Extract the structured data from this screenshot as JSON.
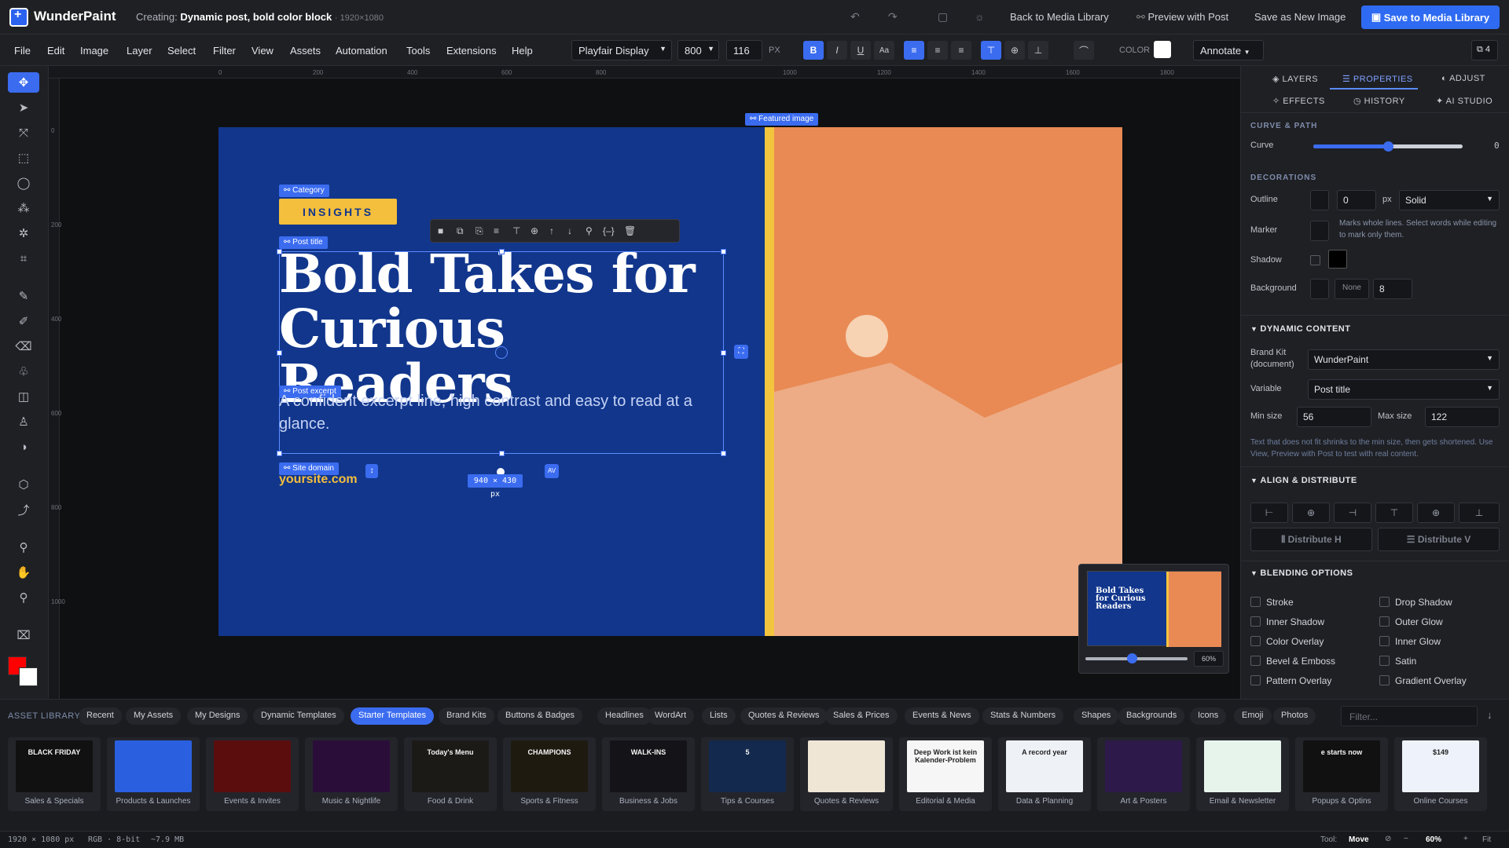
{
  "app": {
    "name": "WunderPaint",
    "creating_label": "Creating:",
    "doc_title": "Dynamic post, bold color block",
    "doc_size": "· 1920×1080"
  },
  "titlebar": {
    "back": "Back to Media Library",
    "preview": "Preview with Post",
    "save_new": "Save as New Image",
    "save_lib": "Save to Media Library"
  },
  "menu": [
    "File",
    "Edit",
    "Image",
    "Layer",
    "Select",
    "Filter",
    "View",
    "Assets",
    "Automation",
    "Tools",
    "Extensions",
    "Help"
  ],
  "format": {
    "font": "Playfair Display",
    "weight": "800",
    "size": "116",
    "unit": "PX",
    "color_label": "COLOR",
    "annotate": "Annotate",
    "panels_count": "4"
  },
  "ruler_top": [
    "0",
    "200",
    "400",
    "600",
    "800",
    "1000",
    "1200",
    "1400",
    "1600",
    "1800"
  ],
  "ruler_left": [
    "0",
    "200",
    "400",
    "600",
    "800",
    "1000"
  ],
  "canvas": {
    "tag_category": "Category",
    "category": "INSIGHTS",
    "tag_title": "Post title",
    "title": "Bold Takes for Curious Readers",
    "tag_excerpt": "Post excerpt",
    "excerpt": "A confident excerpt line, high contrast and easy to read at a glance.",
    "tag_domain": "Site domain",
    "domain": "yoursite.com",
    "tag_featured": "Featured image",
    "size_badge": "940 × 430 px",
    "nav_zoom": "60%",
    "nav_zoom_level": 0.45
  },
  "colors": {
    "accent": "#3b6cf0",
    "artboard": "#11368c",
    "yellow": "#f4bf3c",
    "orange": "#e98a54",
    "fg": "#ff0000",
    "bg": "#ffffff"
  },
  "panel": {
    "tabs": [
      "LAYERS",
      "PROPERTIES",
      "ADJUST",
      "EFFECTS",
      "HISTORY",
      "AI STUDIO"
    ],
    "curve_section": "CURVE & PATH",
    "curve_label": "Curve",
    "curve_value": "0",
    "curve_level": 0.5,
    "deco_section": "DECORATIONS",
    "outline_label": "Outline",
    "outline_value": "0",
    "outline_unit": "px",
    "outline_style": "Solid",
    "marker_label": "Marker",
    "marker_note": "Marks whole lines. Select words while editing to mark only them.",
    "shadow_label": "Shadow",
    "background_label": "Background",
    "background_none": "None",
    "background_value": "8",
    "dyn_section": "DYNAMIC CONTENT",
    "brandkit_label": "Brand Kit (document)",
    "brandkit_value": "WunderPaint",
    "variable_label": "Variable",
    "variable_value": "Post title",
    "min_label": "Min size",
    "min_value": "56",
    "max_label": "Max size",
    "max_value": "122",
    "dyn_note": "Text that does not fit shrinks to the min size, then gets shortened. Use View, Preview with Post to test with real content.",
    "align_section": "ALIGN & DISTRIBUTE",
    "dist_h": "Distribute H",
    "dist_v": "Distribute V",
    "blend_section": "BLENDING OPTIONS",
    "blend": [
      "Stroke",
      "Drop Shadow",
      "Inner Shadow",
      "Outer Glow",
      "Color Overlay",
      "Inner Glow",
      "Bevel & Emboss",
      "Satin",
      "Pattern Overlay",
      "Gradient Overlay"
    ]
  },
  "assets": {
    "title": "ASSET LIBRARY",
    "tabs": [
      "Recent",
      "My Assets",
      "My Designs",
      "Dynamic Templates",
      "Starter Templates",
      "Brand Kits",
      "Buttons & Badges",
      "Headlines",
      "WordArt",
      "Lists",
      "Quotes & Reviews",
      "Sales & Prices",
      "Events & News",
      "Stats & Numbers",
      "Shapes",
      "Backgrounds",
      "Icons",
      "Emoji",
      "Photos"
    ],
    "filter_placeholder": "Filter...",
    "cards": [
      {
        "label": "Sales & Specials",
        "thumb": "BLACK FRIDAY",
        "c": "#111111"
      },
      {
        "label": "Products & Launches",
        "thumb": "",
        "c": "#2a5fe0"
      },
      {
        "label": "Events & Invites",
        "thumb": "",
        "c": "#5b0d0d"
      },
      {
        "label": "Music & Nightlife",
        "thumb": "",
        "c": "#2b0d3a"
      },
      {
        "label": "Food & Drink",
        "thumb": "Today's Menu",
        "c": "#1c1a17"
      },
      {
        "label": "Sports & Fitness",
        "thumb": "CHAMPIONS",
        "c": "#1f1a10"
      },
      {
        "label": "Business & Jobs",
        "thumb": "WALK-INS",
        "c": "#141418"
      },
      {
        "label": "Tips & Courses",
        "thumb": "5",
        "c": "#13294d"
      },
      {
        "label": "Quotes & Reviews",
        "thumb": "",
        "c": "#efe6d6"
      },
      {
        "label": "Editorial & Media",
        "thumb": "Deep Work ist kein Kalender-Problem",
        "c": "#f6f6f6"
      },
      {
        "label": "Data & Planning",
        "thumb": "A record year",
        "c": "#eef1f6"
      },
      {
        "label": "Art & Posters",
        "thumb": "",
        "c": "#2d1a4a"
      },
      {
        "label": "Email & Newsletter",
        "thumb": "",
        "c": "#e7f4ec"
      },
      {
        "label": "Popups & Optins",
        "thumb": "e starts now",
        "c": "#111111"
      },
      {
        "label": "Online Courses",
        "thumb": "$149",
        "c": "#eef3fb"
      }
    ]
  },
  "status": {
    "size": "1920 × 1080 px",
    "mode": "RGB · 8-bit",
    "mem": "~7.9 MB",
    "tool_label": "Tool:",
    "tool": "Move",
    "zoom": "60%",
    "fit": "Fit"
  }
}
